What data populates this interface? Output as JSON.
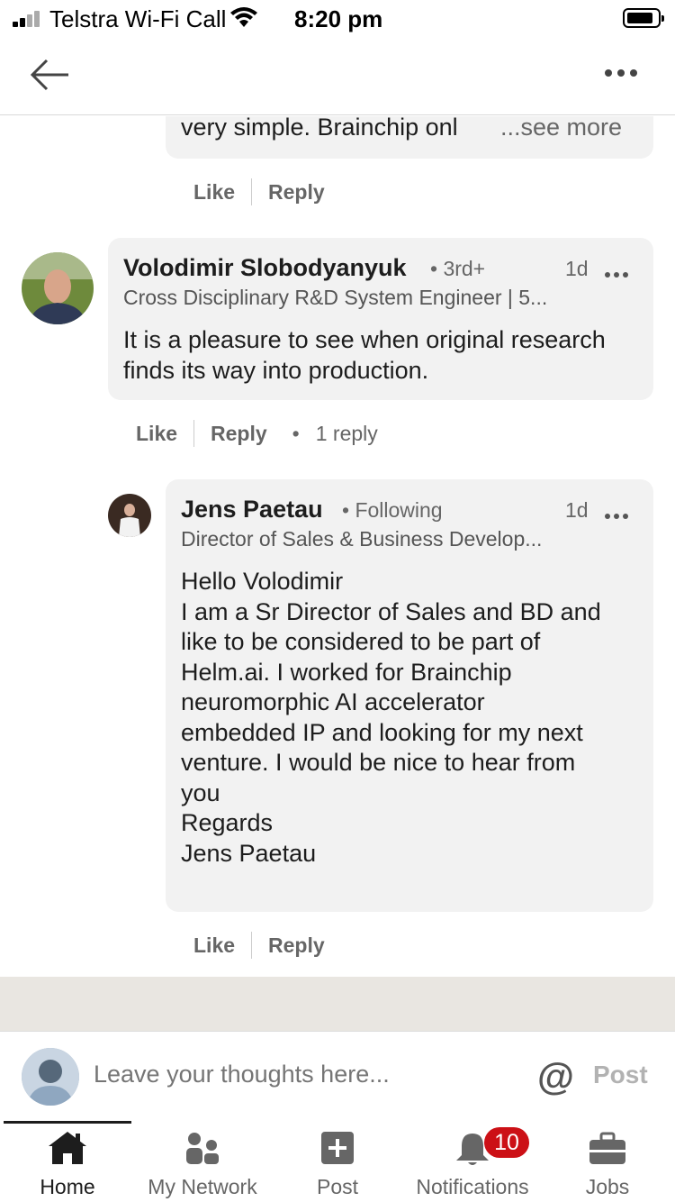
{
  "status_bar": {
    "carrier": "Telstra Wi-Fi Call",
    "time": "8:20 pm",
    "icons": [
      "signal-icon",
      "wifi-icon",
      "battery-icon"
    ]
  },
  "nav": {
    "icons": [
      "back-arrow-icon",
      "more-options-icon"
    ]
  },
  "previous_comment": {
    "text_tail": "very simple. Brainchip onl",
    "see_more": "...see more",
    "like": "Like",
    "reply": "Reply"
  },
  "comment": {
    "name": "Volodimir Slobodyanyuk",
    "degree": "• 3rd+",
    "time": "1d",
    "headline": "Cross Disciplinary R&D System Engineer | 5...",
    "text": "It is a pleasure to see when original research finds its way into production.",
    "like": "Like",
    "reply": "Reply",
    "bullet": "•",
    "reply_count": "1 reply"
  },
  "reply": {
    "name": "Jens Paetau",
    "degree": "• Following",
    "time": "1d",
    "headline": "Director of Sales & Business Develop...",
    "lines": [
      "Hello Volodimir",
      "I am a Sr Director of Sales and BD and",
      "like to be considered to be part of",
      "Helm.ai. I worked for Brainchip",
      "neuromorphic AI accelerator",
      "embedded IP and looking for my next",
      "venture. I would be nice to hear from",
      "you",
      "Regards",
      "Jens Paetau"
    ],
    "like": "Like",
    "reply": "Reply"
  },
  "compose": {
    "placeholder": "Leave your thoughts here...",
    "at": "@",
    "post": "Post"
  },
  "tabs": [
    {
      "label": "Home",
      "icon": "home-icon"
    },
    {
      "label": "My Network",
      "icon": "network-icon"
    },
    {
      "label": "Post",
      "icon": "post-icon"
    },
    {
      "label": "Notifications",
      "icon": "bell-icon"
    },
    {
      "label": "Jobs",
      "icon": "briefcase-icon"
    }
  ],
  "notifications_badge": "10",
  "colors": {
    "badge": "#cc1016",
    "bubble": "#f2f2f2",
    "muted_text": "#666666"
  }
}
